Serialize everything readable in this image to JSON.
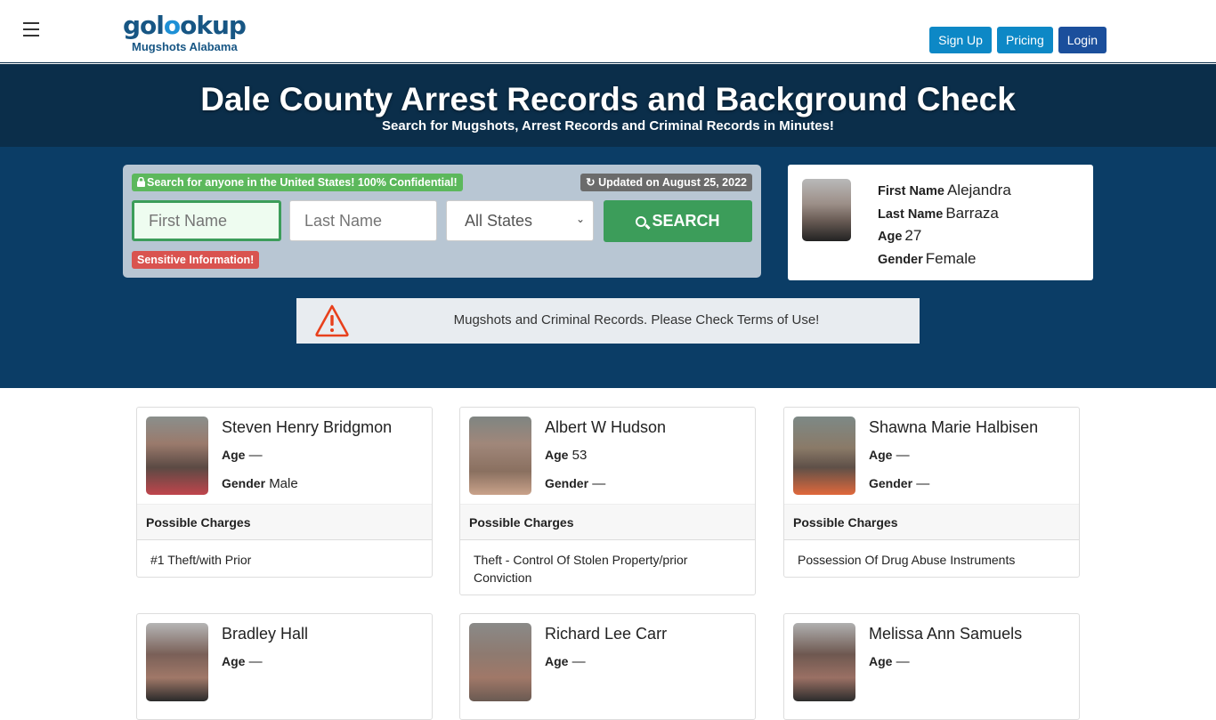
{
  "navbar": {
    "logo_main_pre": "gol",
    "logo_main_accent": "o",
    "logo_main_post": "okup",
    "logo_sub": "Mugshots Alabama",
    "buttons": {
      "signup": "Sign Up",
      "pricing": "Pricing",
      "login": "Login"
    },
    "colors": {
      "signup": "#0d88c6",
      "pricing": "#0d88c6",
      "login": "#1b4f9c"
    }
  },
  "hero": {
    "title": "Dale County Arrest Records and Background Check",
    "subtitle": "Search for Mugshots, Arrest Records and Criminal Records in Minutes!"
  },
  "search": {
    "confidential_badge": "Search for anyone in the United States! 100% Confidential!",
    "updated_badge": "Updated on August 25, 2022",
    "first_name_placeholder": "First Name",
    "last_name_placeholder": "Last Name",
    "state_selected": "All States",
    "search_button": "SEARCH",
    "sensitive_badge": "Sensitive Information!"
  },
  "profile": {
    "first_name_label": "First Name",
    "first_name": "Alejandra",
    "last_name_label": "Last Name",
    "last_name": "Barraza",
    "age_label": "Age",
    "age": "27",
    "gender_label": "Gender",
    "gender": "Female"
  },
  "warning": {
    "text": "Mugshots and Criminal Records. Please Check Terms of Use!"
  },
  "labels": {
    "age": "Age",
    "gender": "Gender",
    "possible_charges": "Possible Charges"
  },
  "records": [
    {
      "name": "Steven Henry Bridgmon",
      "age": "—",
      "gender": "Male",
      "charges": "#1 Theft/with Prior"
    },
    {
      "name": "Albert W Hudson",
      "age": "53",
      "gender": "—",
      "charges": "Theft - Control Of Stolen Property/prior Conviction"
    },
    {
      "name": "Shawna Marie Halbisen",
      "age": "—",
      "gender": "—",
      "charges": "Possession Of Drug Abuse Instruments"
    },
    {
      "name": "Bradley Hall",
      "age": "—"
    },
    {
      "name": "Richard Lee Carr",
      "age": "—"
    },
    {
      "name": "Melissa Ann Samuels",
      "age": "—"
    }
  ]
}
